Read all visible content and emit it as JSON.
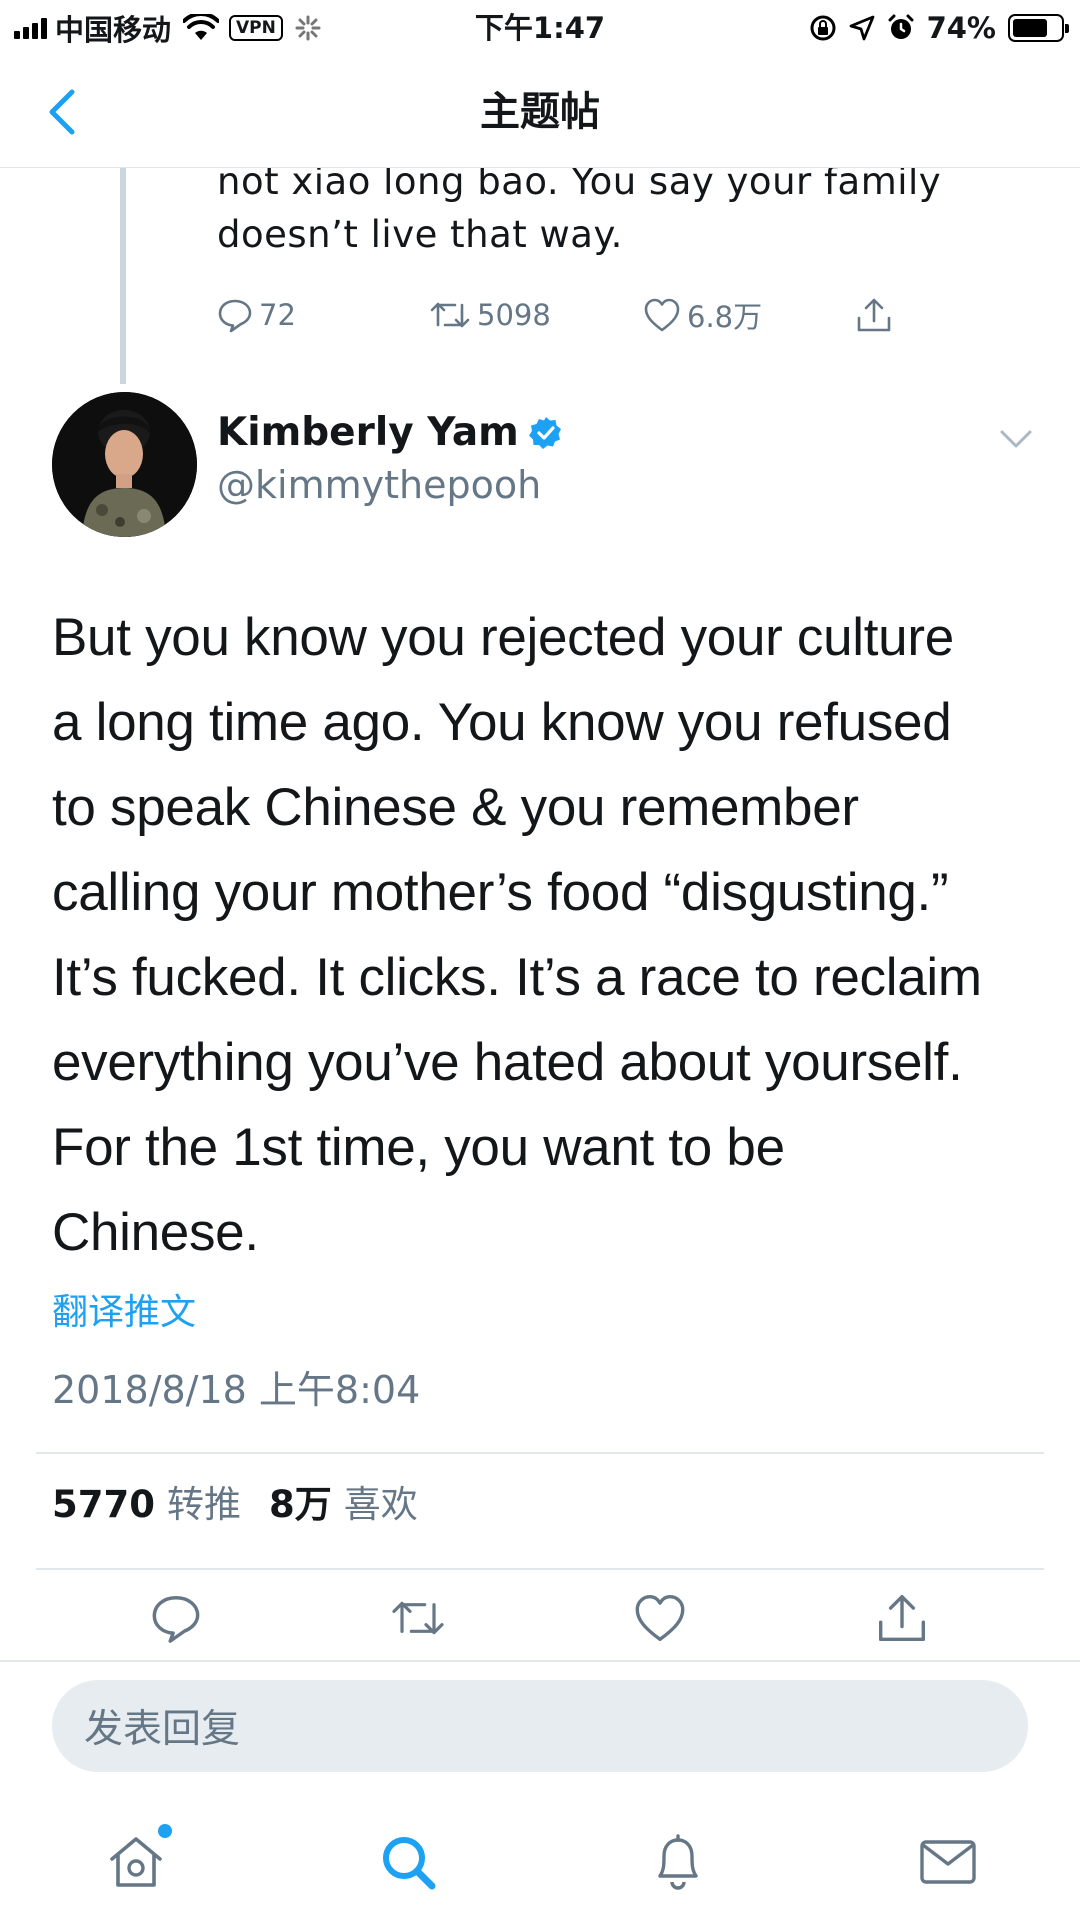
{
  "status_bar": {
    "carrier": "中国移动",
    "vpn": "VPN",
    "time": "下午1:47",
    "battery_percent": "74%",
    "battery_level": 0.74
  },
  "nav": {
    "title": "主题帖"
  },
  "previous_tweet": {
    "text_line1": "not xiao long bao. You say your family",
    "text_line2": "doesn’t live that way.",
    "reply_count": "72",
    "retweet_count": "5098",
    "like_count": "6.8万"
  },
  "tweet": {
    "author_name": "Kimberly Yam",
    "verified": true,
    "author_handle": "@kimmythepooh",
    "lines": [
      "But you know you rejected your culture",
      "a long time ago. You know you refused",
      "to speak Chinese & you remember",
      "calling your mother’s food “disgusting.”",
      "It’s fucked. It clicks. It’s a race to reclaim",
      "everything you’ve hated about yourself.",
      "For the 1st time, you want to be",
      "Chinese."
    ],
    "translate_label": "翻译推文",
    "timestamp": "2018/8/18 上午8:04",
    "retweets": "5770",
    "retweets_label": "转推",
    "likes": "8万",
    "likes_label": "喜欢"
  },
  "reply": {
    "placeholder": "发表回复"
  },
  "colors": {
    "accent": "#1da1f2",
    "muted": "#657786",
    "divider": "#e1e8ed",
    "text": "#14171a"
  },
  "icons": {
    "tabs": [
      "home-icon",
      "search-icon",
      "notifications-icon",
      "messages-icon"
    ]
  }
}
